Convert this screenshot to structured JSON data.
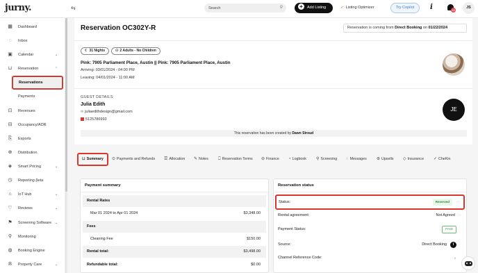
{
  "app": {
    "logo": "jurny.",
    "search_placeholder": "Search",
    "add_listing": "Add Listing",
    "listing_optimizer": "Listing Optimizer",
    "try_copilot": "Try Copilot",
    "info_icon": "i",
    "notification_count": "16",
    "user_initials": "JS"
  },
  "sidebar": {
    "items": [
      {
        "label": "Dashboard",
        "icon": "grid-icon"
      },
      {
        "label": "Inbox",
        "icon": "chat-icon"
      },
      {
        "label": "Calendar",
        "icon": "calendar-icon",
        "chevron": "⌄"
      },
      {
        "label": "Reservation",
        "icon": "bag-icon",
        "chevron": "⌃"
      },
      {
        "label": "Revenues",
        "icon": "revenue-icon"
      },
      {
        "label": "Occupancy/ADR",
        "icon": "occupancy-icon"
      },
      {
        "label": "Exports",
        "icon": "export-icon"
      },
      {
        "label": "Distribution",
        "icon": "distribution-icon"
      },
      {
        "label": "Smart Pricing",
        "icon": "pricing-icon",
        "chevron": "⌄"
      },
      {
        "label": "Reporting βeta",
        "icon": "reporting-icon"
      },
      {
        "label": "IoT Hub",
        "icon": "iot-icon",
        "chevron": "⌄"
      },
      {
        "label": "Reviews",
        "icon": "heart-icon",
        "chevron": "⌄"
      },
      {
        "label": "Screening Software",
        "icon": "flag-icon",
        "chevron": "⌄"
      },
      {
        "label": "Monitoring",
        "icon": "search-icon"
      },
      {
        "label": "Booking Engine",
        "icon": "globe-icon"
      },
      {
        "label": "Property Care",
        "icon": "wrench-icon",
        "chevron": "⌄"
      }
    ],
    "sub_reservations": "Reservations",
    "sub_payments": "Payments"
  },
  "reservation": {
    "title": "Reservation OC302Y-R",
    "source_prefix": "Reservation is coming from",
    "source_name": "Direct Booking",
    "source_on": "on",
    "source_date": "01/22/2024",
    "nights": "31 Nights",
    "guests": "2 Adults - No Children",
    "property_title": "Pink: 7905 Parliament Place, Austin || Pink: 7905 Parliament Place, Austin",
    "arriving": "Arriving: 03/01/2024 - 04:00 PM",
    "leaving": "Leaving: 04/01/2024 - 11:00 AM",
    "guest_details_label": "GUEST DETAILS",
    "guest_name": "Julia Edith",
    "guest_email": "juliaedithdesign@gmail.com",
    "guest_phone": "5125786993",
    "guest_initials": "JE",
    "created_by_prefix": "This reservation has been created by",
    "created_by_name": "Dawn Stroud"
  },
  "tabs": [
    {
      "label": "Summary",
      "icon": "bag-icon",
      "glyph": "⊔"
    },
    {
      "label": "Payments and Refunds",
      "icon": "refund-icon",
      "glyph": "⊙"
    },
    {
      "label": "Allocation",
      "icon": "allocation-icon",
      "glyph": "☰"
    },
    {
      "label": "Notes",
      "icon": "notes-icon",
      "glyph": "✎"
    },
    {
      "label": "Reservation Terms",
      "icon": "bookmark-icon",
      "glyph": "⎕"
    },
    {
      "label": "Finance",
      "icon": "finance-icon",
      "glyph": "⊖"
    },
    {
      "label": "Logbook",
      "icon": "logbook-icon",
      "glyph": "◔"
    },
    {
      "label": "Screening",
      "icon": "search-icon",
      "glyph": "⚲"
    },
    {
      "label": "Messages",
      "icon": "messages-icon",
      "glyph": "◌"
    },
    {
      "label": "Upsells",
      "icon": "upsells-icon",
      "glyph": "⊛"
    },
    {
      "label": "Insurance",
      "icon": "shield-icon",
      "glyph": "◇"
    },
    {
      "label": "CheKin",
      "icon": "check-icon",
      "glyph": "✓"
    }
  ],
  "payment_summary": {
    "title": "Payment summary",
    "rows": [
      {
        "label": "Rental Rates",
        "value": "",
        "style": "header"
      },
      {
        "label": "Mar 01 2024 to Apr 01 2024",
        "value": "$3,348.00",
        "style": "item"
      },
      {
        "label": "Fees",
        "value": "",
        "style": "header"
      },
      {
        "label": "Cleaning Fee",
        "value": "$150.00",
        "style": "indent"
      },
      {
        "label": "Rental total:",
        "value": "$3,498.00",
        "style": "header"
      },
      {
        "label": "Refundable total:",
        "value": "$0.00",
        "style": "plainbold"
      }
    ]
  },
  "reservation_status": {
    "title": "Reservation status",
    "status_label": "Status:",
    "status_value": "Reserved",
    "agreement_label": "Rental agreement:",
    "agreement_value": "Not Agreed",
    "payment_status_label": "Payment Status:",
    "payment_status_value": "PAID",
    "source_label": "Source:",
    "source_value": "Direct Booking",
    "channel_ref_label": "Channel Reference Code:"
  },
  "colors": {
    "highlight_red": "#d9372b",
    "reserved_green": "#2f8a3b",
    "copilot_blue": "#3d7ad6"
  }
}
